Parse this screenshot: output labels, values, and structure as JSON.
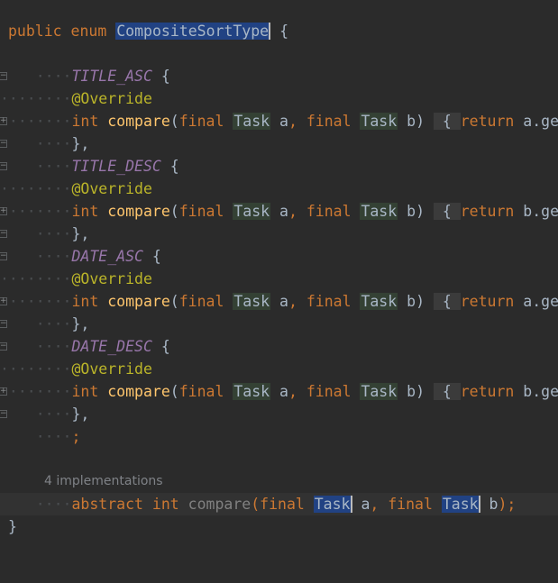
{
  "code": {
    "kw_public": "public",
    "kw_enum": "enum",
    "enum_name": "CompositeSortType",
    "open_brace": "{",
    "close_brace": "}",
    "constants": [
      {
        "name": "TITLE_ASC",
        "var": "a"
      },
      {
        "name": "TITLE_DESC",
        "var": "b"
      },
      {
        "name": "DATE_ASC",
        "var": "a"
      },
      {
        "name": "DATE_DESC",
        "var": "b"
      }
    ],
    "annotation": "@Override",
    "kw_int": "int",
    "method_name": "compare",
    "kw_final": "final",
    "type_name": "Task",
    "param_a": "a",
    "param_b": "b",
    "kw_return": "return",
    "constant_close": "},",
    "semicolon": ";",
    "implementations_hint": "4 implementations",
    "kw_abstract": "abstract"
  },
  "colors": {
    "background": "#2b2b2b",
    "keyword": "#cc7832",
    "constant": "#9876aa",
    "annotation": "#bbb529",
    "method": "#ffc66d",
    "selection": "#214283"
  }
}
